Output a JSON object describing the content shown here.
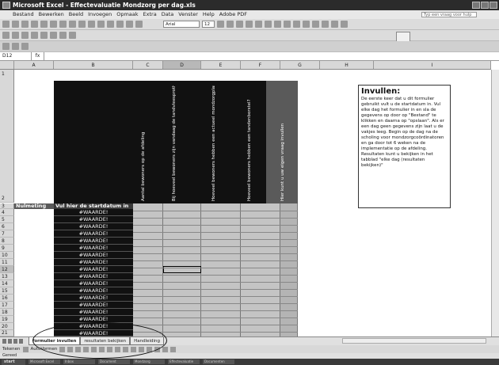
{
  "window": {
    "title": "Microsoft Excel - Effectevaluatie Mondzorg per dag.xls"
  },
  "menu": [
    "Bestand",
    "Bewerken",
    "Beeld",
    "Invoegen",
    "Opmaak",
    "Extra",
    "Data",
    "Venster",
    "Help",
    "Adobe PDF"
  ],
  "help_placeholder": "Typ een vraag voor hulp",
  "toolbar": {
    "font": "Arial",
    "size": "12"
  },
  "formula_bar": {
    "cell": "D12",
    "fx": "fx"
  },
  "columns": [
    "A",
    "B",
    "C",
    "D",
    "E",
    "F",
    "G",
    "H",
    "I"
  ],
  "headers": [
    "Aantal bewoners op de afdeling",
    "Bij hoeveel bewoners zijn vandaag de tandvleesprothese gepoetst?",
    "Hoeveel bewoners hebben een actueel mondzorgplan?",
    "Hoeveel bewoners hebben een tandenborstel?",
    "Hier kunt u uw eigen vraag invullen"
  ],
  "row3": {
    "a": "Nulmeting",
    "b": "Vul hier de startdatum in"
  },
  "rows": [
    "1",
    "2",
    "3",
    "4",
    "5",
    "6",
    "7",
    "8",
    "9",
    "10",
    "11",
    "12",
    "13",
    "14",
    "15",
    "16",
    "17",
    "18",
    "19",
    "20",
    "21"
  ],
  "error_value": "#WAARDE!",
  "info": {
    "title": "Invullen:",
    "text": "De eerste keer dat u dit formulier gebruikt vult u de startdatum in. Vul elke dag het formulier in en sla de gegevens op door op \"Bestand\" te klikken en daarna op \"opslaan\". Als er een dag geen gegevens zijn laat u de vakjes leeg. Begin op de dag na de scholing voor mondzorgcoördinatoren en ga door tot 6 weken na de implementatie op de afdeling. Resultaten kunt u bekijken in het tabblad \"elke dag (resultaten bekijken)\""
  },
  "tabs": [
    "formulier invullen",
    "resultaten bekijken",
    "Handleiding"
  ],
  "drawbar": {
    "draw": "Tekenen",
    "autoshapes": "AutoVormen"
  },
  "status": "Gereed",
  "taskbar": {
    "start": "start",
    "items": [
      "Microsoft Excel",
      "Inbox",
      "Document",
      "Mondzorg",
      "Effectevaluatie",
      "Documenten"
    ]
  }
}
